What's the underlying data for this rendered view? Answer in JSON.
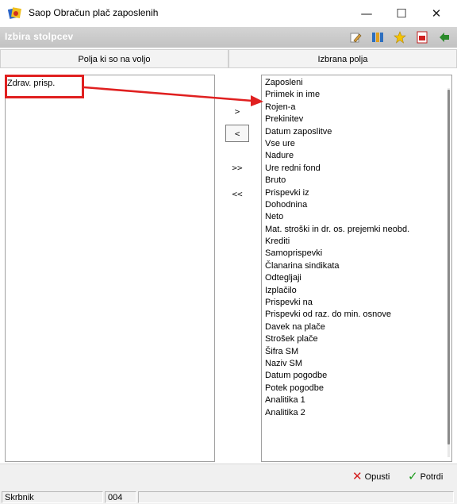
{
  "window": {
    "title": "Saop Obračun plač zaposlenih",
    "minimize": "—",
    "maximize": "☐",
    "close": "✕"
  },
  "header": {
    "title": "Izbira stolpcev"
  },
  "columns": {
    "available_label": "Polja ki so na voljo",
    "selected_label": "Izbrana polja"
  },
  "available_fields": [
    "Zdrav. prisp."
  ],
  "selected_fields": [
    "Zaposleni",
    "Priimek in ime",
    "Rojen-a",
    "Prekinitev",
    "Datum zaposlitve",
    "Vse ure",
    "Nadure",
    "Ure redni fond",
    "Bruto",
    "Prispevki iz",
    "Dohodnina",
    "Neto",
    "Mat. stroški in dr. os. prejemki neobd.",
    "Krediti",
    "Samoprispevki",
    "Članarina sindikata",
    "Odtegljaji",
    "Izplačilo",
    "Prispevki na",
    "Prispevki od raz. do min. osnove",
    "Davek na plače",
    "Strošek plače",
    "Šifra SM",
    "Naziv SM",
    "Datum pogodbe",
    "Potek pogodbe",
    "Analitika 1",
    "Analitika 2"
  ],
  "transfer_buttons": {
    "add_one": ">",
    "remove_one": "<",
    "add_all": ">>",
    "remove_all": "<<"
  },
  "footer": {
    "cancel_label": "Opusti",
    "confirm_label": "Potrdi"
  },
  "status": {
    "user": "Skrbnik",
    "code": "004"
  },
  "colors": {
    "header_bg": "#c8c8c8",
    "annotation": "#e02020",
    "cancel_icon": "#d42020",
    "confirm_icon": "#1a9a1a"
  }
}
